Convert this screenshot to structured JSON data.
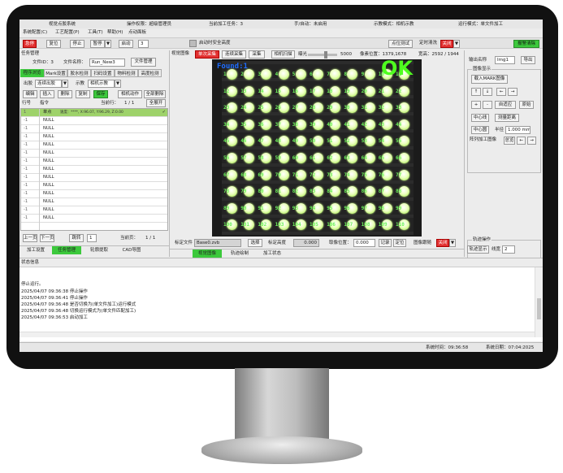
{
  "menubar": {
    "app_title": "视觉点胶系统",
    "permission": "操作权限：超级管理员",
    "current_task": "当前加工任务：3",
    "hand_auto": "手/自动：未启用",
    "teach_mode": "示教模式：相机示教",
    "run_mode": "运行模式：单文件加工",
    "menu": [
      "系统配置(C)",
      "工艺配置(P)",
      "工具(T)",
      "帮助(H)",
      "点动面板"
    ]
  },
  "toolbar": {
    "estop": "急停",
    "reset": "复位",
    "stop": "停止",
    "pause": "暂停",
    "start": "启动",
    "count": "3",
    "safe_height": "启动时安全高度",
    "point_test": "点位测试",
    "timed_clean": "定时清洗",
    "off": "关闭",
    "alarm_clear": "报警清除"
  },
  "task_panel": {
    "title": "任务管理",
    "file_id_label": "文件ID：3",
    "file_name_label": "文件名称：",
    "file_name_value": "Run_New3",
    "file_manage": "文件管理",
    "tabs": [
      "程序浏览",
      "Mark设置",
      "胶水检测",
      "扫码设置",
      "物料检测",
      "高度检测"
    ],
    "out_label": "出胶",
    "out_value": "连续出胶",
    "teach_label": "示教",
    "teach_value": "相机示教",
    "buttons": [
      "编辑",
      "插入",
      "删除",
      "复制",
      "保存",
      "相机动作",
      "全部删除"
    ],
    "col_line": "行号",
    "col_cmd": "指令",
    "current_line": "当前行：",
    "page_count": "1 / 1",
    "all_expand": "全展开",
    "rows": [
      {
        "line": "1",
        "cmd": "单点",
        "detail": "速度：****, X:96.07, Y:96.29, Z:0.00"
      },
      {
        "line": "-1",
        "cmd": "NULL",
        "detail": ""
      },
      {
        "line": "-1",
        "cmd": "NULL",
        "detail": ""
      },
      {
        "line": "-1",
        "cmd": "NULL",
        "detail": ""
      },
      {
        "line": "-1",
        "cmd": "NULL",
        "detail": ""
      },
      {
        "line": "-1",
        "cmd": "NULL",
        "detail": ""
      },
      {
        "line": "-1",
        "cmd": "NULL",
        "detail": ""
      },
      {
        "line": "-1",
        "cmd": "NULL",
        "detail": ""
      },
      {
        "line": "-1",
        "cmd": "NULL",
        "detail": ""
      },
      {
        "line": "-1",
        "cmd": "NULL",
        "detail": ""
      },
      {
        "line": "-1",
        "cmd": "NULL",
        "detail": ""
      },
      {
        "line": "-1",
        "cmd": "NULL",
        "detail": ""
      },
      {
        "line": "-1",
        "cmd": "NULL",
        "detail": ""
      },
      {
        "line": "-1",
        "cmd": "NULL",
        "detail": ""
      }
    ],
    "prev_page": "上一页",
    "next_page": "下一页",
    "jump": "跳转",
    "jump_value": "1",
    "current_page": "当前页：",
    "page_value": "1 / 1",
    "bottom_tabs": [
      "加工设置",
      "任务管理",
      "轮廓提取",
      "CAD导图"
    ]
  },
  "vision": {
    "title": "视觉图像",
    "single_capture": "单次采集",
    "continuous": "连续采集",
    "capture": "采集",
    "camera_scan": "相机扫描",
    "exposure": "曝光",
    "exposure_value": "5000",
    "exposure_level": 0.55,
    "pixel_pos": "像素位置：1379,1678",
    "size": "宽高：2592 / 1944",
    "found_text": "Found:1",
    "ok_text": "OK",
    "calib_file_label": "标定文件",
    "calib_file_value": "Base0.zvb",
    "select": "选择",
    "calib_height_label": "标定高度",
    "calib_height_value": "0.000",
    "pick_pos_label": "取像位置：",
    "pick_pos_value": "0.000",
    "record": "记录",
    "locate": "定位",
    "follow": "图像跟随",
    "follow_state": "关闭",
    "bottom_tabs": [
      "视觉图像",
      "轨迹绘制",
      "加工状态"
    ]
  },
  "right_panel": {
    "out_name_label": "输出名称",
    "out_name_value": "Img1",
    "export": "导出",
    "display_title": "图像显示",
    "load_mark": "载入MARK图像",
    "arrows": [
      "↑",
      "↓",
      "←",
      "→"
    ],
    "zoom": [
      "+",
      "-"
    ],
    "fit": "自适应",
    "origin": "原始",
    "center_line": "中心线",
    "measure": "测量距离",
    "center_circle": "中心圆",
    "radius_label": "半径",
    "radius_value": "1.000 mm",
    "array_label": "阵列加工图像",
    "array_btn": "总览",
    "track_title": "轨迹操作",
    "track_display": "轨迹显示",
    "line_width_label": "线宽",
    "line_width_value": "2",
    "track_edit": "轨迹编辑",
    "track_draw": "轨迹绘制"
  },
  "status": {
    "title": "状态信息",
    "logs": [
      "停止运行。",
      "2025/04/07 09:36:38   停止操作",
      "2025/04/07 09:36:41   停止操作",
      "2025/04/07 09:36:48   是否切换为(单文件加工)运行模式",
      "2025/04/07 09:36:48   切换运行模式为(单文件匹配加工)",
      "2025/04/07 09:36:53   启动加工"
    ],
    "sys_time": "系统时间：09:36:58",
    "sys_date": "系统日期：07:04:2025"
  },
  "grid": {
    "rows": [
      [
        "1",
        "2",
        "3",
        "4",
        "5",
        "6",
        "7",
        "8",
        "9",
        "10",
        "11"
      ],
      [
        "12",
        "13",
        "14",
        "15",
        "16",
        "17",
        "18",
        "19",
        "20",
        "21",
        "22"
      ],
      [
        "23",
        "24",
        "25",
        "26",
        "27",
        "28",
        "29",
        "30",
        "31",
        "32",
        "33"
      ],
      [
        "34",
        "35",
        "36",
        "37",
        "38",
        "39",
        "40",
        "41",
        "42",
        "43",
        "44"
      ],
      [
        "45",
        "46",
        "47",
        "48",
        "49",
        "50",
        "51",
        "52",
        "53",
        "54",
        "55"
      ],
      [
        "56",
        "57",
        "58",
        "59",
        "60",
        "61",
        "62",
        "63",
        "64",
        "65",
        "66"
      ],
      [
        "67",
        "68",
        "69",
        "70",
        "71",
        "72",
        "73",
        "74",
        "75",
        "76",
        "77"
      ],
      [
        "78",
        "79",
        "80",
        "81",
        "82",
        "83",
        "84",
        "85",
        "86",
        "87",
        "88"
      ],
      [
        "89",
        "90",
        "91",
        "92",
        "93",
        "94",
        "95",
        "96",
        "97",
        "98",
        "99"
      ],
      [
        "100",
        "101",
        "102",
        "103",
        "104",
        "105",
        "106",
        "107",
        "108",
        "109",
        "110"
      ]
    ]
  },
  "colors": {
    "accent_green": "#3cc93c",
    "alarm_red": "#e23030",
    "led_green": "#b8f06a"
  }
}
